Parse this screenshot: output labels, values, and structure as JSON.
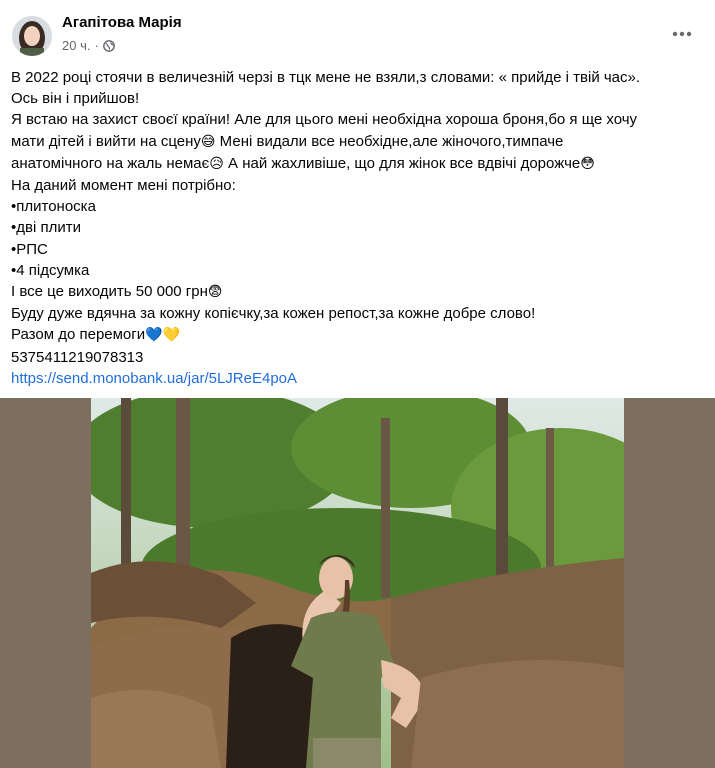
{
  "post": {
    "author": "Агапітова Марія",
    "time": "20 ч.",
    "separator": "·",
    "privacy_icon": "globe-icon",
    "more_icon": "more-horizontal-icon",
    "lines": [
      "В 2022 році стоячи в величезній черзі в тцк мене не взяли,з словами: « прийде і твій час».",
      "Ось він і прийшов!",
      "Я встаю на захист своєї країни! Але для цього мені необхідна хороша броня,бо я ще хочу",
      "мати дітей і вийти на сцену",
      " Мені видали все необхідне,але жіночого,тимпаче",
      "анатомічного на жаль немає",
      " А най жахливіше, що  для жінок все вдвічі дорожче",
      "На даний момент мені потрібно:",
      "•плитоноска",
      "•дві плити",
      "•РПС",
      "•4 підсумка",
      "І все це виходить  50 000 грн",
      "Буду дуже вдячна за кожну копієчку,за кожен репост,за кожне добре слово!",
      "Разом до перемоги",
      "5375411219078313"
    ],
    "emojis": {
      "grin": "😅",
      "worried": "😥",
      "flushed": "😳",
      "shock": "😨",
      "blue_heart": "💙",
      "yellow_heart": "💛"
    },
    "link": "https://send.monobank.ua/jar/5LJReE4poA"
  },
  "colors": {
    "text": "#050505",
    "secondary": "#65676b",
    "link": "#216fdb",
    "photo_frame": "#7c6f60"
  }
}
